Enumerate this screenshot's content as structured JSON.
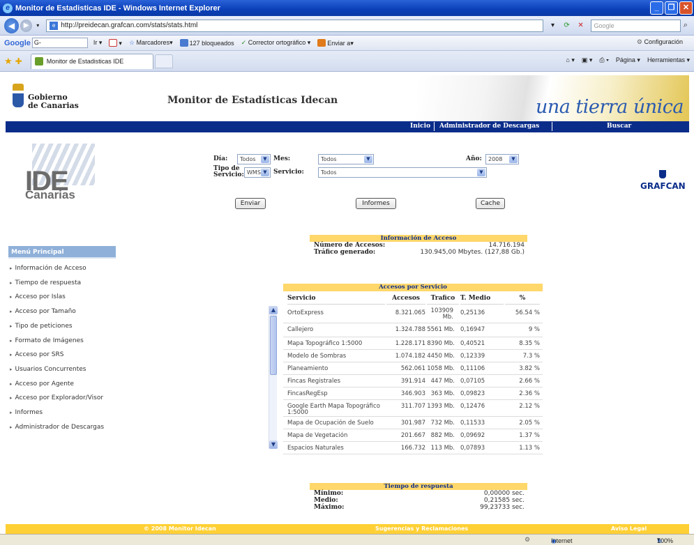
{
  "browser": {
    "window_title": "Monitor de Estadisticas IDE - Windows Internet Explorer",
    "url": "http://preidecan.grafcan.com/stats/stats.html",
    "search_placeholder": "Google",
    "google_toolbar": {
      "logo": "Google",
      "search_box": "G-",
      "go_label": "Ir",
      "marcadores": "Marcadores",
      "bloqueados": "127 bloqueados",
      "corrector": "Corrector ortográfico",
      "enviar": "Enviar a",
      "configuracion": "Configuración"
    },
    "tab_title": "Monitor de Estadisticas IDE",
    "tools": {
      "pagina": "Página",
      "herramientas": "Herramientas"
    },
    "status": {
      "zone": "Internet",
      "zoom": "100%"
    }
  },
  "header": {
    "org_line1": "Gobierno",
    "org_line2": "de Canarias",
    "site_title": "Monitor de Estadísticas Idecan",
    "slogan": "una tierra única"
  },
  "nav": {
    "inicio": "Inicio",
    "descargas": "Administrador de Descargas",
    "buscar": "Buscar"
  },
  "logos": {
    "ide": "IDE",
    "canarias": "Canarias",
    "grafcan": "GRAFCAN"
  },
  "form": {
    "dia_label": "Día:",
    "dia_value": "Todos",
    "mes_label": "Mes:",
    "mes_value": "Todos",
    "anio_label": "Año:",
    "anio_value": "2008",
    "tipo_label_1": "Tipo de",
    "tipo_label_2": "Servicio:",
    "tipo_value": "WMS",
    "servicio_label": "Servicio:",
    "servicio_value": "Todos",
    "enviar": "Enviar",
    "informes": "Informes",
    "cache": "Cache"
  },
  "sidebar": {
    "title": "Menú Principal",
    "items": [
      "Información de Acceso",
      "Tiempo de respuesta",
      "Acceso por Islas",
      "Acceso por Tamaño",
      "Tipo de peticiones",
      "Formato de Imágenes",
      "Acceso por SRS",
      "Usuarios Concurrentes",
      "Acceso por Agente",
      "Acceso por Explorador/Visor",
      "Informes",
      "Administrador de Descargas"
    ]
  },
  "info_acceso": {
    "title": "Información de Acceso",
    "accesos_label": "Número de Accesos:",
    "accesos_value": "14.716.194",
    "trafico_label": "Tráfico generado:",
    "trafico_value": "130.945,00 Mbytes. (127,88 Gb.)"
  },
  "table": {
    "title": "Accesos por Servicio",
    "columns": [
      "Servicio",
      "Accesos",
      "Trafico",
      "T. Medio",
      "%"
    ],
    "rows": [
      [
        "OrtoExpress",
        "8.321.065",
        "103909 Mb.",
        "0,25136",
        "56.54 %"
      ],
      [
        "Callejero",
        "1.324.788",
        "5561 Mb.",
        "0,16947",
        "9 %"
      ],
      [
        "Mapa Topográfico 1:5000",
        "1.228.171",
        "8390 Mb.",
        "0,40521",
        "8.35 %"
      ],
      [
        "Modelo de Sombras",
        "1.074.182",
        "4450 Mb.",
        "0,12339",
        "7.3 %"
      ],
      [
        "Planeamiento",
        "562.061",
        "1058 Mb.",
        "0,11106",
        "3.82 %"
      ],
      [
        "Fincas Registrales",
        "391.914",
        "447 Mb.",
        "0,07105",
        "2.66 %"
      ],
      [
        "FincasRegEsp",
        "346.903",
        "363 Mb.",
        "0,09823",
        "2.36 %"
      ],
      [
        "Google Earth Mapa Topográfico 1:5000",
        "311.707",
        "1393 Mb.",
        "0,12476",
        "2.12 %"
      ],
      [
        "Mapa de Ocupación de Suelo",
        "301.987",
        "732 Mb.",
        "0,11533",
        "2.05 %"
      ],
      [
        "Mapa de Vegetación",
        "201.667",
        "882 Mb.",
        "0,09692",
        "1.37 %"
      ],
      [
        "Espacios Naturales",
        "166.732",
        "113 Mb.",
        "0,07893",
        "1.13 %"
      ]
    ]
  },
  "tiempo": {
    "title": "Tiempo de respuesta",
    "min_label": "Mínimo:",
    "min_value": "0,00000 sec.",
    "med_label": "Medio:",
    "med_value": "0,21585 sec.",
    "max_label": "Máximo:",
    "max_value": "99,23733 sec."
  },
  "footer": {
    "copyright": "© 2008 Monitor Idecan",
    "sugerencias": "Sugerencias y Reclamaciones",
    "aviso": "Aviso Legal"
  }
}
